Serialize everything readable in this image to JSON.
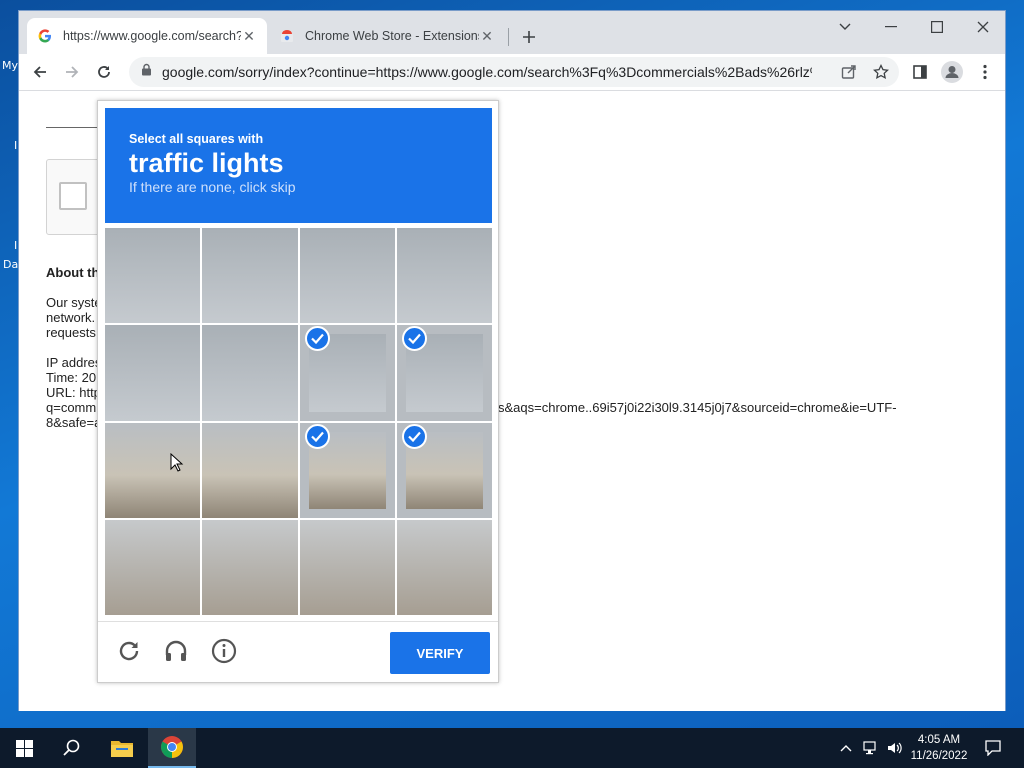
{
  "desktop": {
    "fragments": [
      "My",
      "I",
      "I",
      "Da"
    ]
  },
  "browser": {
    "tabs": [
      {
        "title": "https://www.google.com/search?q"
      },
      {
        "title": "Chrome Web Store - Extensions"
      }
    ],
    "url": "google.com/sorry/index?continue=https://www.google.com/search%3Fq%3Dcommercials%2Bads%26rlz%..."
  },
  "page": {
    "heading": "About th",
    "para1": [
      "Our syste",
      "network.",
      "requests"
    ],
    "ip_lines": [
      "IP addres",
      "Time: 20",
      "URL: http",
      "q=comm",
      "8&safe=a"
    ],
    "url_tail1": "s&aqs=chrome..69i57j0i22i30l9.3145j0j7&sourceid=chrome&ie=UTF-",
    "url_tail2": ""
  },
  "captcha": {
    "instruction": "Select all squares with",
    "target": "traffic lights",
    "hint": "If there are none, click skip",
    "verify_label": "VERIFY",
    "tiles": [
      {
        "scene": "sky",
        "selected": false
      },
      {
        "scene": "sky",
        "selected": false
      },
      {
        "scene": "sky",
        "selected": false
      },
      {
        "scene": "sky",
        "selected": false
      },
      {
        "scene": "sky",
        "selected": false
      },
      {
        "scene": "sky",
        "selected": false
      },
      {
        "scene": "sky",
        "selected": true
      },
      {
        "scene": "sky",
        "selected": true
      },
      {
        "scene": "ground",
        "selected": false
      },
      {
        "scene": "ground",
        "selected": false
      },
      {
        "scene": "ground",
        "selected": true
      },
      {
        "scene": "ground",
        "selected": true
      },
      {
        "scene": "road",
        "selected": false
      },
      {
        "scene": "road",
        "selected": false
      },
      {
        "scene": "road",
        "selected": false
      },
      {
        "scene": "road",
        "selected": false
      }
    ]
  },
  "taskbar": {
    "time": "4:05 AM",
    "date": "11/26/2022"
  },
  "colors": {
    "accent": "#1a73e8",
    "taskbar": "#0d1a2b"
  }
}
